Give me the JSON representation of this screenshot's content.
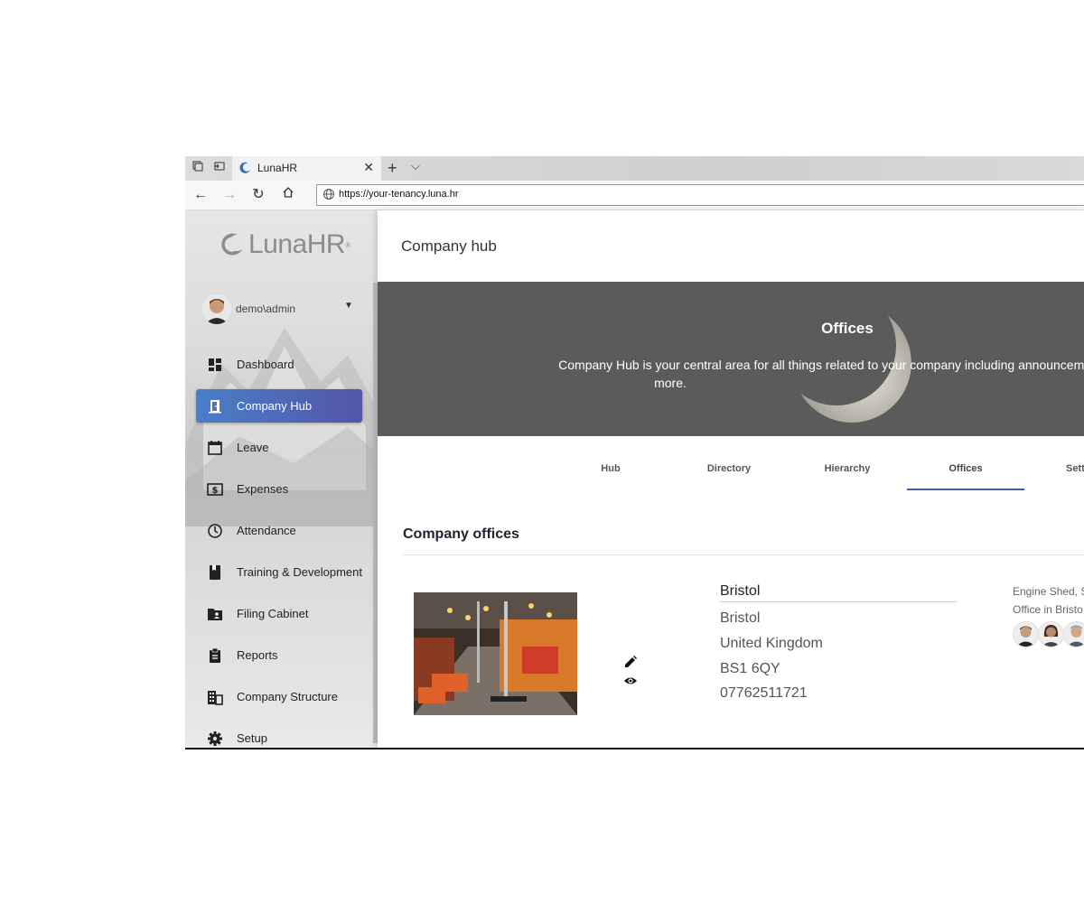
{
  "browser": {
    "tab_title": "LunaHR",
    "url": "https://your-tenancy.luna.hr",
    "icons": [
      "tab-actions-icon",
      "tabs-aside-icon",
      "close-icon",
      "new-tab-icon",
      "chevron-down-icon",
      "back-icon",
      "forward-icon",
      "refresh-icon",
      "home-icon",
      "globe-icon"
    ]
  },
  "sidebar": {
    "logo_text": "LunaHR",
    "user_name": "demo\\admin",
    "items": [
      {
        "label": "Dashboard",
        "icon": "dashboard-icon"
      },
      {
        "label": "Company Hub",
        "icon": "door-icon",
        "active": true
      },
      {
        "label": "Leave",
        "icon": "calendar-icon"
      },
      {
        "label": "Expenses",
        "icon": "money-icon"
      },
      {
        "label": "Attendance",
        "icon": "clock-icon"
      },
      {
        "label": "Training & Development",
        "icon": "book-icon"
      },
      {
        "label": "Filing Cabinet",
        "icon": "folder-icon"
      },
      {
        "label": "Reports",
        "icon": "clipboard-icon"
      },
      {
        "label": "Company Structure",
        "icon": "building-icon"
      },
      {
        "label": "Setup",
        "icon": "gear-icon"
      }
    ],
    "active_color": "#4a7ec8"
  },
  "main": {
    "page_title": "Company hub",
    "banner": {
      "title": "Offices",
      "text_line1": "Company Hub is your central area for all things related to your company including announcements, dire",
      "text_line2": "more."
    },
    "tabs": [
      "Hub",
      "Directory",
      "Hierarchy",
      "Offices",
      "Sett"
    ],
    "active_tab": "Offices",
    "section_title": "Company offices",
    "office": {
      "name": "Bristol",
      "city": "Bristol",
      "country": "United Kingdom",
      "postcode": "BS1 6QY",
      "phone": "07762511721",
      "desc_line1": "Engine Shed, S",
      "desc_line2": "Office in Bristo"
    }
  }
}
